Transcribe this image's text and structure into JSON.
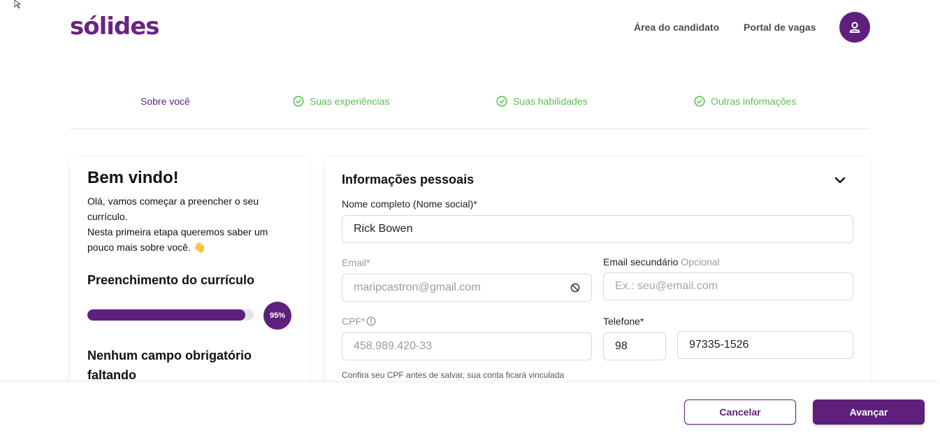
{
  "header": {
    "logo": "sólides",
    "nav_candidate": "Área do candidato",
    "nav_jobs": "Portal de vagas",
    "avatar_icon": "user-icon"
  },
  "steps": [
    {
      "label": "Sobre você",
      "status": "current"
    },
    {
      "label": "Suas experiências",
      "status": "done"
    },
    {
      "label": "Suas habilidades",
      "status": "done"
    },
    {
      "label": "Outras informações",
      "status": "done"
    }
  ],
  "welcome": {
    "title": "Bem vindo!",
    "line1": "Olá, vamos começar a preencher o seu currículo.",
    "line2": "Nesta primeira etapa queremos saber um pouco mais sobre você. 👋",
    "progress_title": "Preenchimento do currículo",
    "progress_value": 0.95,
    "progress_label": "95%",
    "status_text": "Nenhum campo obrigatório faltando"
  },
  "personal": {
    "title": "Informações pessoais",
    "name_label": "Nome completo (Nome social)*",
    "name_value": "Rick Bowen",
    "email_label": "Email*",
    "email_value": "maripcastron@gmail.com",
    "email2_label": "Email secundário",
    "email2_optional": "Opcional",
    "email2_placeholder": "Ex.: seu@email.com",
    "cpf_label": "CPF*",
    "cpf_value": "458.989.420-33",
    "cpf_help": "Confira seu CPF antes de salvar, sua conta ficará vinculada",
    "phone_label": "Telefone*",
    "phone_ddd": "98",
    "phone_number": "97335-1526"
  },
  "footer": {
    "cancel": "Cancelar",
    "next": "Avançar"
  },
  "colors": {
    "brand": "#5e1f7d",
    "success": "#5cc04f"
  }
}
